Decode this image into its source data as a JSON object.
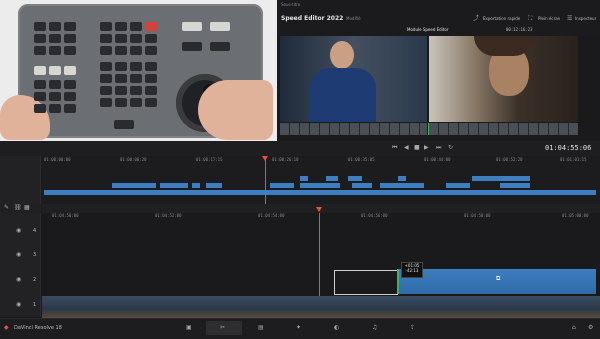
{
  "app": {
    "project_title": "Speed Editor 2022",
    "project_status": "Modifié",
    "brand": "DaVinci Resolve 18",
    "top_left_label": "Sous-titre"
  },
  "header": {
    "quick_export": "Exportation rapide",
    "full_screen": "Plein écran",
    "inspector": "Inspecteur",
    "viewer_mode": "Module Speed Editor",
    "timecode_small": "00:12:16:23"
  },
  "transport": {
    "timecode": "01:04:55:06"
  },
  "upper_timeline": {
    "ticks": [
      "01:00:00:00",
      "01:00:08:20",
      "01:00:17:15",
      "01:00:26:10",
      "01:00:35:05",
      "01:00:44:00",
      "01:00:52:20",
      "01:01:01:15"
    ]
  },
  "lower_timeline": {
    "ticks": [
      "01:04:50:00",
      "01:04:52:00",
      "01:04:54:00",
      "01:04:56:00",
      "01:04:58:00",
      "01:05:00:00"
    ],
    "tracks": [
      "4",
      "3",
      "2",
      "1"
    ],
    "clip_tooltip_1": "+01:05",
    "clip_tooltip_2": "-42:13"
  },
  "colors": {
    "accent_blue": "#3d7ec0",
    "playhead": "#e0533d",
    "audio_green": "#3fb25b"
  },
  "icons": {
    "play": "play-icon",
    "stop": "stop-icon",
    "loop": "loop-icon",
    "settings": "gear-icon",
    "home": "home-icon"
  }
}
